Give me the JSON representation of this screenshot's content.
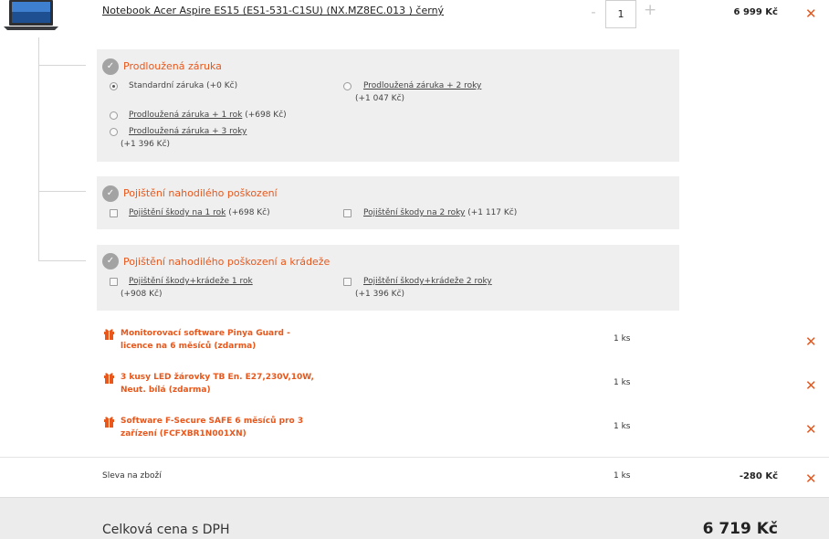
{
  "product": {
    "name": "Notebook Acer Aspire ES15 (ES1-531-C1SU) (NX.MZ8EC.013 ) černý",
    "quantity": "1",
    "minus_label": "-",
    "plus_label": "+",
    "price": "6 999 Kč",
    "remove_label": "✕"
  },
  "warranty": {
    "title": "Prodloužená záruka",
    "options": [
      {
        "label": "Standardní záruka",
        "price": "(+0 Kč)",
        "selected": true
      },
      {
        "label": "Prodloužená záruka + 2 roky",
        "price": "(+1 047 Kč)",
        "selected": false
      },
      {
        "label": "Prodloužená záruka + 1 rok",
        "price": "(+698 Kč)",
        "selected": false
      },
      {
        "label": "Prodloužená záruka + 3 roky",
        "price": "(+1 396 Kč)",
        "selected": false
      }
    ]
  },
  "damage_insurance": {
    "title": "Pojištění nahodilého poškození",
    "options": [
      {
        "label": "Pojištění škody na 1 rok",
        "price": "(+698 Kč)",
        "checked": false
      },
      {
        "label": "Pojištění škody na 2 roky",
        "price": "(+1 117 Kč)",
        "checked": false
      }
    ]
  },
  "theft_insurance": {
    "title": "Pojištění nahodilého poškození a krádeže",
    "options": [
      {
        "label": "Pojištění škody+krádeže 1 rok",
        "price": "(+908 Kč)",
        "checked": false
      },
      {
        "label": "Pojištění škody+krádeže 2 roky",
        "price": "(+1 396 Kč)",
        "checked": false
      }
    ]
  },
  "gifts": [
    {
      "line1": "Monitorovací software Pinya Guard -",
      "line2": "licence na 6 měsíců (zdarma)",
      "qty": "1 ks"
    },
    {
      "line1": "3 kusy LED žárovky TB En. E27,230V,10W,",
      "line2": "Neut. bílá (zdarma)",
      "qty": "1 ks"
    },
    {
      "line1": "Software F-Secure SAFE 6 měsíců pro 3",
      "line2": "zařízení (FCFXBR1N001XN)",
      "qty": "1 ks"
    }
  ],
  "discount": {
    "label": "Sleva na zboží",
    "qty": "1 ks",
    "price": "-280 Kč"
  },
  "total": {
    "label": "Celková cena s DPH",
    "price": "6 719 Kč"
  },
  "colors": {
    "accent": "#e8571b",
    "panel": "#efefef",
    "icon_grey": "#a3a3a3"
  },
  "icons": {
    "thumb": "laptop-thumbnail",
    "remove": "close-icon",
    "service": "shield-check-icon",
    "gift": "gift-icon"
  }
}
